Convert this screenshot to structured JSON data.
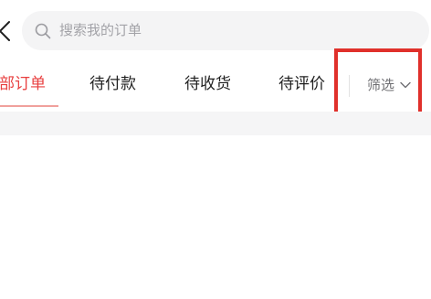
{
  "header": {
    "back_icon": "chevron-left-icon"
  },
  "search": {
    "icon": "search-icon",
    "placeholder": "搜索我的订单"
  },
  "tabs": [
    {
      "label": "全部订单",
      "active": true
    },
    {
      "label": "待付款",
      "active": false
    },
    {
      "label": "待收货",
      "active": false
    },
    {
      "label": "待评价",
      "active": false
    }
  ],
  "filter": {
    "label": "筛选",
    "icon": "chevron-down-icon"
  },
  "colors": {
    "accent": "#e83f3f",
    "highlight_box": "#e0302b",
    "search_bg": "#f4f4f5",
    "text": "#1f1f1f",
    "muted_text": "#6f6f73"
  }
}
